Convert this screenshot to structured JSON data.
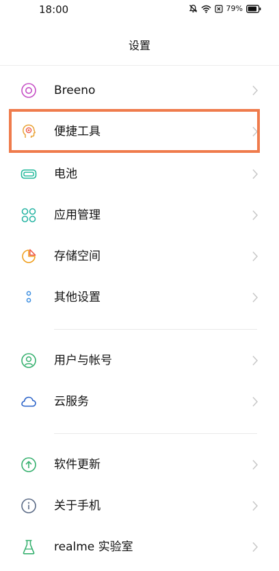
{
  "status_bar": {
    "time": "18:00",
    "battery_percent": "79%",
    "icons": [
      "mute-bell-icon",
      "wifi-icon",
      "sim-x-icon",
      "battery-icon"
    ]
  },
  "header": {
    "title": "设置"
  },
  "menu": {
    "items": [
      {
        "label": "Breeno",
        "icon": "breeno-icon",
        "color": "#c54ec5"
      },
      {
        "label": "便捷工具",
        "icon": "smart-assist-icon",
        "color": "#e9a233"
      },
      {
        "label": "电池",
        "icon": "battery-icon",
        "color": "#20b89a"
      },
      {
        "label": "应用管理",
        "icon": "apps-grid-icon",
        "color": "#2bb6a5"
      },
      {
        "label": "存储空间",
        "icon": "storage-pie-icon",
        "color": "#f0a020"
      },
      {
        "label": "其他设置",
        "icon": "more-dots-icon",
        "color": "#3a8de0"
      },
      {
        "label": "用户与帐号",
        "icon": "user-account-icon",
        "color": "#35b06e"
      },
      {
        "label": "云服务",
        "icon": "cloud-icon",
        "color": "#2b63c9"
      },
      {
        "label": "软件更新",
        "icon": "update-arrow-icon",
        "color": "#35b06e"
      },
      {
        "label": "关于手机",
        "icon": "info-icon",
        "color": "#5b6b86"
      },
      {
        "label": "realme 实验室",
        "icon": "lab-flask-icon",
        "color": "#35b06e"
      }
    ]
  },
  "colors": {
    "highlight_border": "#ef7b4c",
    "chevron": "#c7c7c7",
    "divider": "#e9e9e9"
  }
}
